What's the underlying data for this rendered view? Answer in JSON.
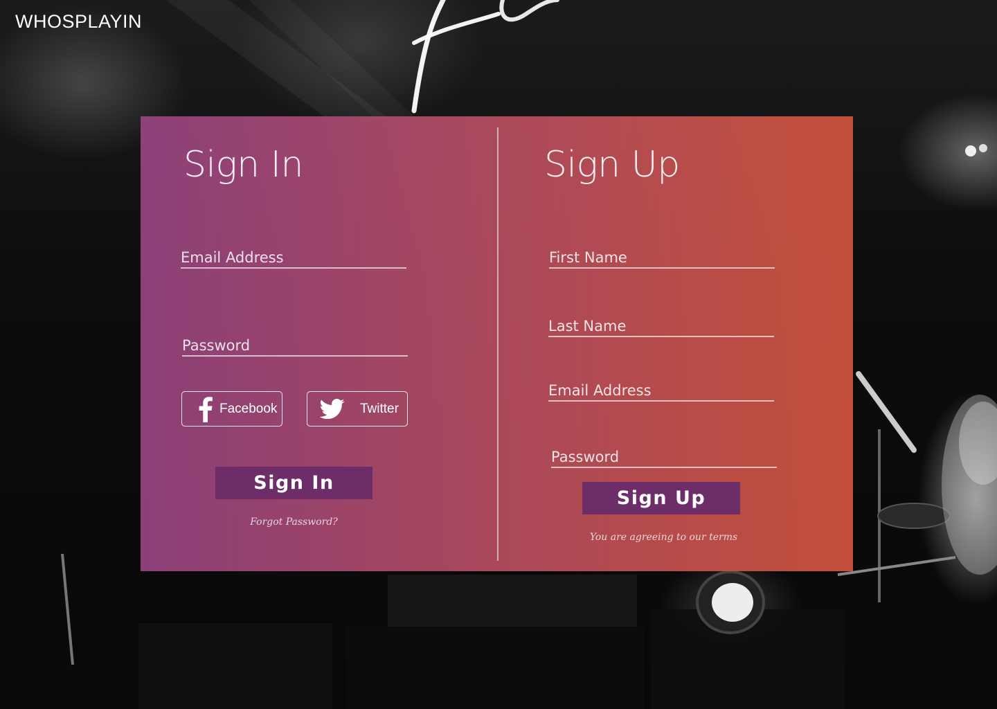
{
  "brand": {
    "logo": "WHOSPLAYIN"
  },
  "signin": {
    "title": "Sign In",
    "email_placeholder": "Email Address",
    "password_placeholder": "Password",
    "facebook_label": "Facebook",
    "twitter_label": "Twitter",
    "submit_label": "Sign In",
    "forgot_label": "Forgot Password?"
  },
  "signup": {
    "title": "Sign Up",
    "first_name_placeholder": "First Name",
    "last_name_placeholder": "Last Name",
    "email_placeholder": "Email Address",
    "password_placeholder": "Password",
    "submit_label": "Sign Up",
    "terms_label": "You are agreeing to our terms"
  },
  "icons": {
    "facebook": "facebook-icon",
    "twitter": "twitter-icon"
  },
  "colors": {
    "button": "#6c2d68",
    "gradient_left": "#a0488a",
    "gradient_right": "#d6563e"
  }
}
